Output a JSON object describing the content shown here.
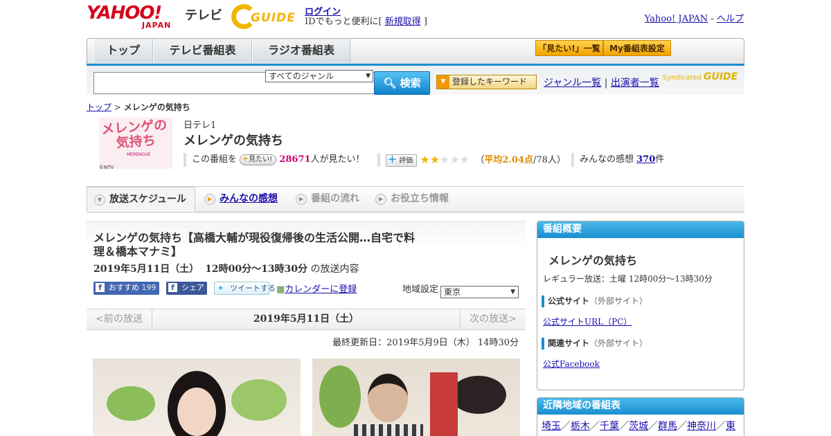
{
  "header": {
    "logo_yahoo": "YAHOO!",
    "logo_japan": "JAPAN",
    "logo_tv": "テレビ",
    "gguide_logo": "GUIDE",
    "login": "ログイン",
    "login_sub_prefix": "IDでもっと便利に[ ",
    "login_sub_link": "新規取得",
    "login_sub_suffix": " ]",
    "yahoo_japan_link": "Yahoo! JAPAN",
    "separator": " - ",
    "help_link": "ヘルプ"
  },
  "nav": {
    "tabs": [
      "トップ",
      "テレビ番組表",
      "ラジオ番組表"
    ],
    "want_list": "「見たい!」一覧",
    "my_settings": "My番組表設定"
  },
  "search": {
    "input_value": "",
    "genre_selected": "すべてのジャンル",
    "button_label": "検索",
    "keyword_button": "登録したキーワード",
    "genre_list": "ジャンル一覧",
    "link_sep": " | ",
    "performer_list": "出演者一覧",
    "syndicated": "Syndicated",
    "syndicated_logo": "GUIDE"
  },
  "breadcrumb": {
    "top": "トップ",
    "sep": " > ",
    "current": "メレンゲの気持ち"
  },
  "program": {
    "thumb_title_line1": "メレンゲの",
    "thumb_title_line2": "気持ち",
    "thumb_sub": "MERENGUE",
    "thumb_copyright": "©NTV",
    "channel": "日テレ1",
    "title": "メレンゲの気持ち",
    "want_prefix": "この番組を",
    "want_button": "見たい!",
    "want_count": "28671",
    "want_suffix": "人が見たい！",
    "eval_button": "評価",
    "rating_stars": 2,
    "rating_open": "（",
    "rating_avg_label": "平均2.04点",
    "rating_count": "/78人）",
    "impressions_prefix": "みんなの感想 ",
    "impressions_count": "370",
    "impressions_suffix": "件"
  },
  "content_tabs": [
    "放送スケジュール",
    "みんなの感想",
    "番組の流れ",
    "お役立ち情報"
  ],
  "episode": {
    "title": "メレンゲの気持ち【高橋大輔が現役復帰後の生活公開…自宅で料理＆橋本マナミ】",
    "date": "2019年5月11日（土）",
    "time": "12時00分～13時30分",
    "date_suffix": "の放送内容",
    "fb_recommend": "おすすめ",
    "fb_count": "199",
    "fb_share": "シェア",
    "tweet": "ツイートする",
    "calendar": "カレンダーに登録",
    "region_label": "地域設定",
    "region_selected": "東京"
  },
  "datenav": {
    "prev": "<前の放送",
    "current": "2019年5月11日（土）",
    "next": "次の放送>"
  },
  "last_updated": "最終更新日：2019年5月9日（木） 14時30分",
  "sidebar": {
    "overview_head": "番組概要",
    "overview_title": "メレンゲの気持ち",
    "regular": "レギュラー放送：土曜 12時00分～13時30分",
    "official_head": "公式サイト",
    "official_note": "（外部サイト）",
    "official_link": "公式サイトURL（PC）",
    "related_head": "関連サイト",
    "related_note": "（外部サイト）",
    "related_link": "公式Facebook",
    "nearby_head": "近隣地域の番組表",
    "nearby": [
      "埼玉",
      "栃木",
      "千葉",
      "茨城",
      "群馬",
      "神奈川",
      "東"
    ],
    "nearby_sep": "／"
  },
  "colors": {
    "accent_blue": "#1a8fd0",
    "yahoo_red": "#d6001c",
    "gguide_yellow": "#f5b400",
    "hot_pink": "#d0006f"
  }
}
